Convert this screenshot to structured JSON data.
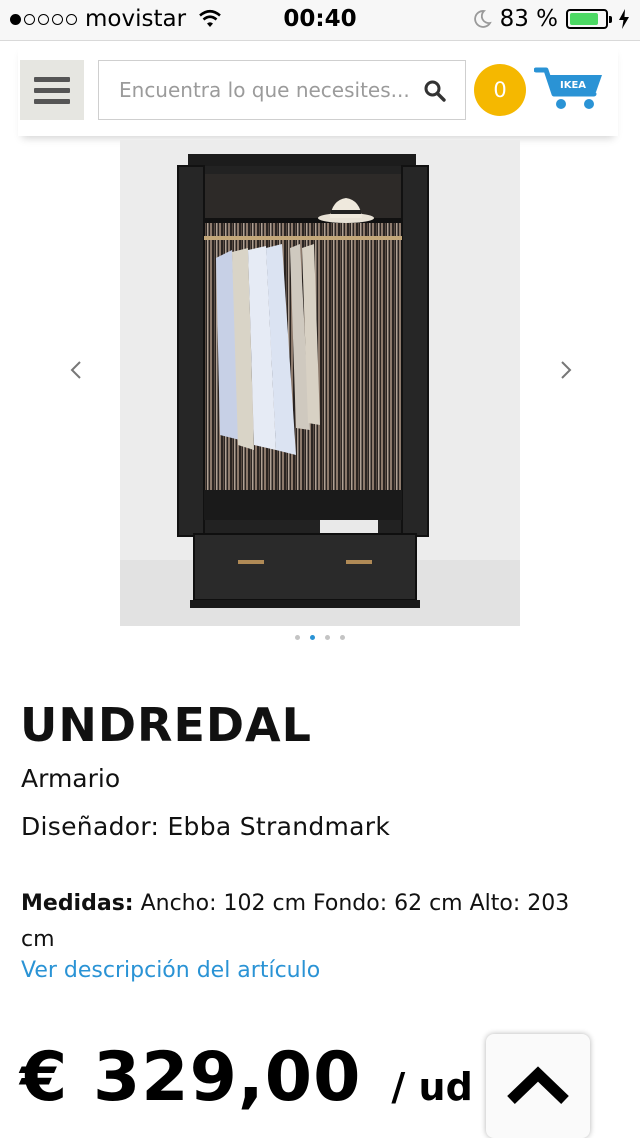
{
  "status_bar": {
    "carrier": "movistar",
    "time": "00:40",
    "battery_percent": "83 %",
    "battery_level": 0.83,
    "signal_bars_filled": 1,
    "signal_bars_total": 5,
    "icons": [
      "wifi-icon",
      "moon-icon",
      "battery-icon",
      "charging-icon"
    ]
  },
  "header": {
    "search_placeholder": "Encuentra lo que necesites...",
    "cart_count": "0",
    "cart_logo_text": "IKEA",
    "icons": [
      "menu-icon",
      "search-icon",
      "cart-icon"
    ],
    "colors": {
      "badge": "#f5b800",
      "cart": "#2a93d5",
      "menu_bg": "#e6e6e1"
    }
  },
  "gallery": {
    "total_images": 4,
    "active_index": 1,
    "icons": [
      "chevron-left-icon",
      "chevron-right-icon"
    ]
  },
  "product": {
    "name": "UNDREDAL",
    "type": "Armario",
    "designer": "Diseñador: Ebba Strandmark",
    "measures_label": "Medidas:",
    "measures_value": "Ancho: 102 cm Fondo: 62 cm Alto: 203 cm",
    "description_link": "Ver descripción del artículo",
    "price": "€ 329,00",
    "unit": "/ ud",
    "colors": {
      "link": "#2a93d5"
    }
  },
  "scroll_top": {
    "icon": "chevron-up-icon"
  }
}
